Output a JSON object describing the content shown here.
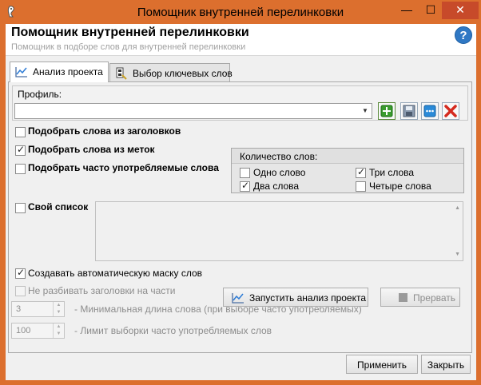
{
  "window": {
    "title": "Помощник внутренней перелинковки",
    "minimize_glyph": "—",
    "maximize_glyph": "☐",
    "close_glyph": "✕",
    "frame_color": "#dc6f2e"
  },
  "header": {
    "title": "Помощник внутренней перелинковки",
    "subtitle": "Помощник в подборе слов для внутренней перелинковки",
    "help_glyph": "?"
  },
  "tabs": [
    {
      "label": "Анализ проекта",
      "active": true,
      "icon": "chart-icon"
    },
    {
      "label": "Выбор ключевых слов",
      "active": false,
      "icon": "keywords-icon"
    }
  ],
  "profile": {
    "label": "Профиль:",
    "value": "",
    "buttons": [
      "add-profile",
      "save-profile",
      "more-options",
      "delete-profile"
    ]
  },
  "options": {
    "from_headings": {
      "label": "Подобрать слова из заголовков",
      "checked": false
    },
    "from_tags": {
      "label": "Подобрать слова из меток",
      "checked": true
    },
    "frequent": {
      "label": "Подобрать часто употребляемые слова",
      "checked": false
    },
    "own_list": {
      "label": "Свой список",
      "checked": false
    }
  },
  "word_count": {
    "title": "Количество слов:",
    "one": {
      "label": "Одно слово",
      "checked": false
    },
    "two": {
      "label": "Два слова",
      "checked": true
    },
    "three": {
      "label": "Три слова",
      "checked": true
    },
    "four": {
      "label": "Четыре слова",
      "checked": false
    }
  },
  "auto_mask": {
    "label": "Создавать автоматическую маску слов",
    "checked": true
  },
  "no_split_headings": {
    "label": "Не разбивать заголовки на части",
    "checked": false,
    "disabled": true
  },
  "min_length": {
    "value": "3",
    "label": "- Минимальная длина слова (при выборе часто употребляемых)"
  },
  "limit": {
    "value": "100",
    "label": "- Лимит выборки часто употребляемых слов"
  },
  "buttons": {
    "run": "Запустить анализ проекта",
    "stop": "Прервать",
    "apply": "Применить",
    "close": "Закрыть"
  }
}
